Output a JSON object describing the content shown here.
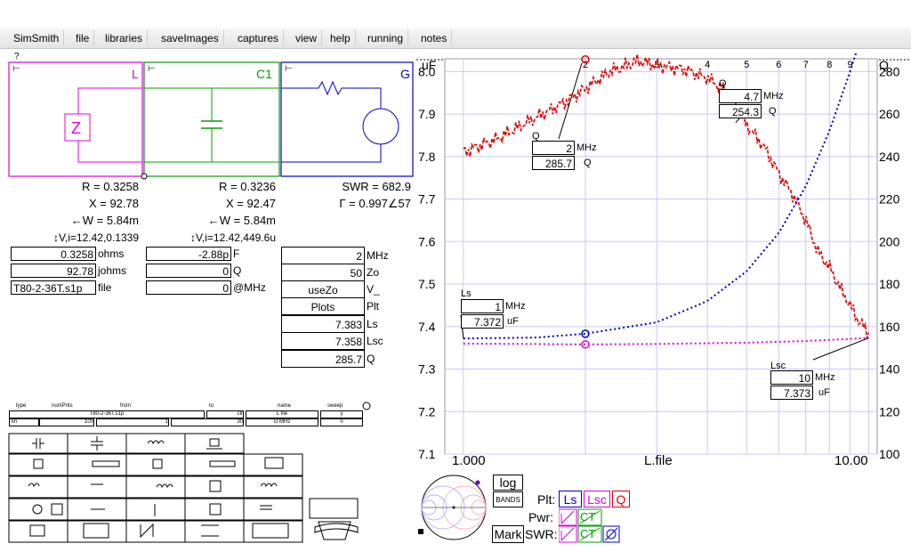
{
  "menu": [
    "SimSmith",
    "file",
    "libraries",
    "saveImages",
    "captures",
    "view",
    "help",
    "running",
    "notes"
  ],
  "help_mark": "?",
  "circuit": {
    "labels": {
      "L": "L",
      "C1": "C1",
      "G": "G"
    },
    "colors": {
      "L": "#e000e0",
      "C1": "#00a000",
      "G": "#0000cc"
    },
    "z_glyph": "Z"
  },
  "readouts": {
    "col1": {
      "r": "R = 0.3258",
      "x": "X = 92.78",
      "w": "←W = 5.84m",
      "vi": "↕V,i=12.42,0.1339"
    },
    "col2": {
      "r": "R = 0.3236",
      "x": "X = 92.47",
      "w": "←W = 5.84m",
      "vi": "↕V,i=12.42,449.6u"
    },
    "col3": {
      "swr": "SWR = 682.9",
      "gamma": "Γ = 0.997∠57"
    }
  },
  "load_fields": [
    {
      "value": "0.3258",
      "unit": "ohms"
    },
    {
      "value": "92.78",
      "unit": "johms"
    },
    {
      "value": "T80-2-36T.s1p",
      "unit": "file"
    }
  ],
  "cap_fields": [
    {
      "value": "-2.88p",
      "unit": "F"
    },
    {
      "value": "0",
      "unit": "Q"
    },
    {
      "value": "0",
      "unit": "@MHz"
    }
  ],
  "gen_fields": [
    {
      "value": "2",
      "unit": "MHz"
    },
    {
      "value": "50",
      "unit": "Zo"
    },
    {
      "value": "useZo",
      "unit": "V_"
    },
    {
      "value": "Plots",
      "unit": "Plt"
    },
    {
      "value": "7.383",
      "unit": "Ls"
    },
    {
      "value": "7.358",
      "unit": "Lsc"
    },
    {
      "value": "285.7",
      "unit": "Q"
    }
  ],
  "file_table": {
    "headers": [
      "type",
      "numPnts",
      "from",
      "to",
      "name",
      "sweep"
    ],
    "row1": [
      "T80-2-36T.s1p",
      "clr",
      "L file",
      "y"
    ],
    "row2": [
      "lin",
      "100",
      "1",
      "30",
      "G MHz",
      "n"
    ]
  },
  "chart_data": {
    "type": "line",
    "xlabel": "L.file",
    "x_scale": "log",
    "xlim": [
      0.9,
      10.5
    ],
    "x_ticks_top": [
      "2",
      "3",
      "4",
      "5",
      "6",
      "7",
      "8",
      "9"
    ],
    "x_ticks_bottom": [
      "1.000",
      "10.00"
    ],
    "y_left": {
      "unit": "uF",
      "ticks": [
        "8.0",
        "7.9",
        "7.8",
        "7.7",
        "7.6",
        "7.5",
        "7.4",
        "7.3",
        "7.2",
        "7.1"
      ],
      "lim": [
        7.1,
        8.03
      ]
    },
    "y_right": {
      "unit": "Q",
      "ticks": [
        "280",
        "260",
        "240",
        "220",
        "200",
        "180",
        "160",
        "140",
        "120",
        "100"
      ],
      "lim": [
        100,
        286
      ]
    },
    "series": [
      {
        "name": "Q",
        "color": "#e00000",
        "style": "dashed-noisy",
        "x": [
          1.0,
          1.2,
          1.5,
          1.8,
          2.0,
          2.3,
          2.7,
          3.0,
          3.5,
          4.0,
          4.5,
          5.0,
          5.5,
          6.0,
          6.5,
          7.0,
          7.5,
          8.0,
          8.5,
          9.0,
          9.5,
          10.0
        ],
        "values": [
          242,
          248,
          258,
          266,
          272,
          280,
          285,
          283,
          281,
          277,
          270,
          255,
          245,
          232,
          222,
          210,
          195,
          188,
          178,
          170,
          162,
          157
        ]
      },
      {
        "name": "Ls",
        "color": "#0000cc",
        "style": "dotted",
        "x": [
          1.0,
          1.5,
          2.0,
          3.0,
          4.0,
          5.0,
          6.0,
          7.0,
          8.0,
          9.0,
          9.5,
          10.0
        ],
        "values": [
          7.372,
          7.374,
          7.383,
          7.41,
          7.46,
          7.53,
          7.62,
          7.73,
          7.86,
          8.0,
          8.07,
          8.12
        ]
      },
      {
        "name": "Lsc",
        "color": "#e000e0",
        "style": "dotted",
        "x": [
          1.0,
          2.0,
          3.0,
          5.0,
          7.0,
          10.0
        ],
        "values": [
          7.36,
          7.358,
          7.359,
          7.362,
          7.366,
          7.373
        ]
      }
    ],
    "markers": [
      {
        "series": "Q",
        "mhz": "2",
        "value": "285.7",
        "unit": "Q"
      },
      {
        "series": "Q",
        "mhz": "4.7",
        "value": "254.3",
        "unit": "Q"
      },
      {
        "series": "Ls",
        "mhz": "1",
        "value": "7.372",
        "unit": "uF"
      },
      {
        "series": "Lsc",
        "mhz": "10",
        "value": "7.373",
        "unit": "uF"
      }
    ],
    "marker_unit_mhz": "MHz"
  },
  "controls": {
    "log": "log",
    "bands": "BANDS",
    "mark": "Mark",
    "plt_label": "Plt:",
    "plt_buttons": [
      {
        "label": "Ls",
        "color": "#0000cc"
      },
      {
        "label": "Lsc",
        "color": "#e000e0"
      },
      {
        "label": "Q",
        "color": "#e00000"
      }
    ],
    "pwr_label": "Pwr:",
    "swr_label": "SWR:",
    "ct": "CT"
  }
}
